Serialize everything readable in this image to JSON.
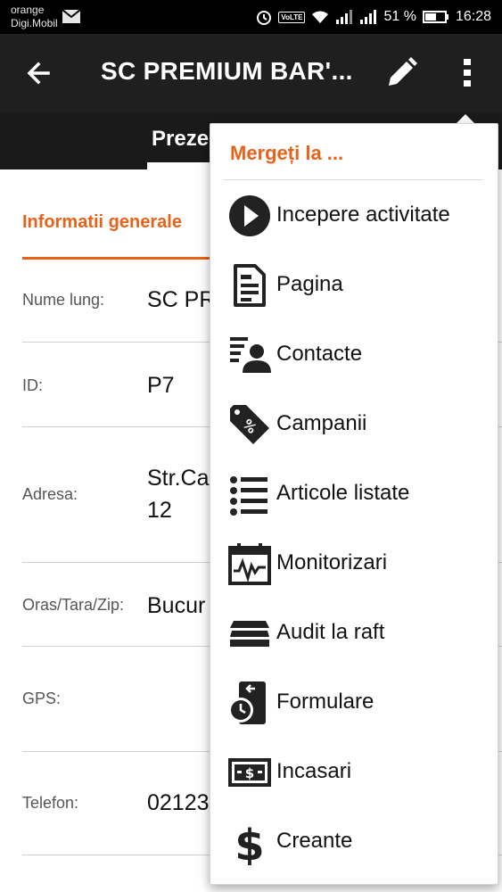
{
  "status_bar": {
    "carrier_line1": "orange",
    "carrier_line2": "Digi.Mobil",
    "volte": "VoLTE",
    "battery": "51 %",
    "time": "16:28"
  },
  "app_bar": {
    "title": "SC PREMIUM BAR'..."
  },
  "tabs": {
    "active_label": "Preze"
  },
  "section": {
    "title": "Informatii generale"
  },
  "fields": [
    {
      "label": "Nume lung:",
      "value": "SC PR"
    },
    {
      "label": "ID:",
      "value": "P7"
    },
    {
      "label": "Adresa:",
      "value": "Str.Ca\n12"
    },
    {
      "label": "Oras/Tara/Zip:",
      "value": "Bucur"
    },
    {
      "label": "GPS:",
      "value": ""
    },
    {
      "label": "Telefon:",
      "value": "02123"
    }
  ],
  "menu": {
    "header": "Mergeți la ...",
    "items": [
      {
        "label": "Incepere activitate",
        "icon": "play-circle-icon"
      },
      {
        "label": "Pagina",
        "icon": "document-icon"
      },
      {
        "label": "Contacte",
        "icon": "contacts-icon"
      },
      {
        "label": "Campanii",
        "icon": "discount-tag-icon"
      },
      {
        "label": "Articole listate",
        "icon": "list-icon"
      },
      {
        "label": "Monitorizari",
        "icon": "calendar-chart-icon"
      },
      {
        "label": "Audit la raft",
        "icon": "shelf-stack-icon"
      },
      {
        "label": "Formulare",
        "icon": "form-clock-icon"
      },
      {
        "label": "Incasari",
        "icon": "cash-icon"
      },
      {
        "label": "Creante",
        "icon": "dollar-icon"
      }
    ]
  }
}
